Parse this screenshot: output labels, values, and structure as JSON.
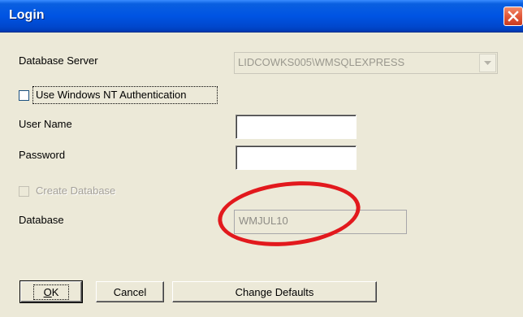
{
  "window": {
    "title": "Login"
  },
  "form": {
    "database_server": {
      "label": "Database Server",
      "value": "LIDCOWKS005\\WMSQLEXPRESS"
    },
    "nt_auth": {
      "label": "Use Windows NT Authentication",
      "checked": false
    },
    "user_name": {
      "label": "User Name",
      "value": ""
    },
    "password": {
      "label": "Password",
      "value": ""
    },
    "create_database": {
      "label": "Create Database",
      "checked": false,
      "enabled": false
    },
    "database": {
      "label": "Database",
      "value": "WMJUL10"
    }
  },
  "buttons": {
    "ok_prefix": "",
    "ok_accel": "O",
    "ok_rest": "K",
    "cancel": "Cancel",
    "change_defaults": "Change Defaults"
  },
  "annotation": {
    "color": "#e2191d"
  },
  "colors": {
    "titlebar": "#0054e3",
    "dialog_bg": "#ece9d8",
    "close_button": "#e2583a"
  }
}
